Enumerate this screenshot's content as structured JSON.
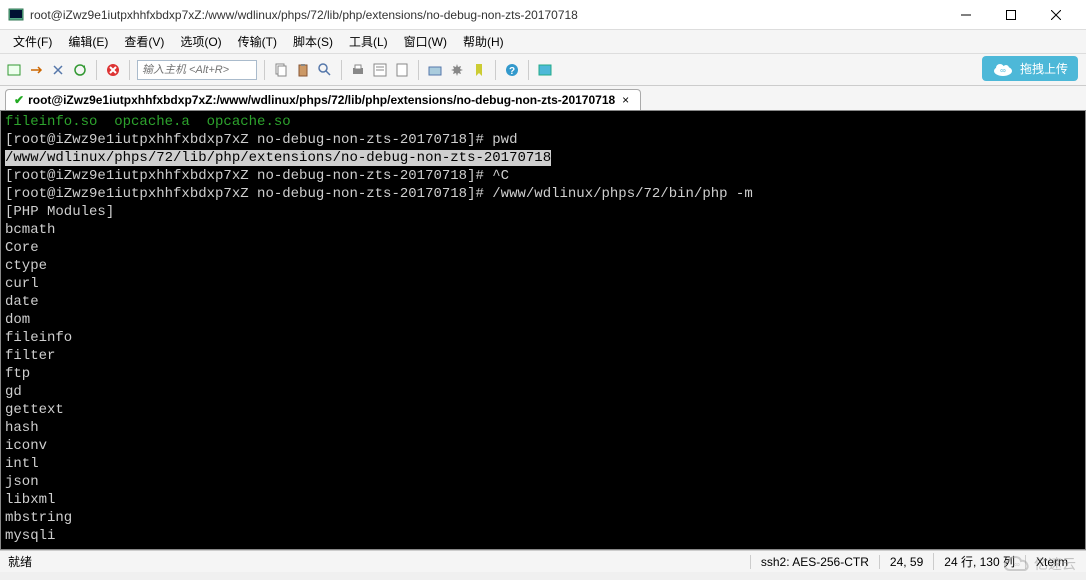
{
  "window": {
    "title": "root@iZwz9e1iutpxhhfxbdxp7xZ:/www/wdlinux/phps/72/lib/php/extensions/no-debug-non-zts-20170718"
  },
  "menubar": {
    "file": "文件(F)",
    "edit": "编辑(E)",
    "view": "查看(V)",
    "options": "选项(O)",
    "transfer": "传输(T)",
    "script": "脚本(S)",
    "tools": "工具(L)",
    "window": "窗口(W)",
    "help": "帮助(H)"
  },
  "toolbar": {
    "host_placeholder": "输入主机 <Alt+R>"
  },
  "upload_badge": {
    "label": "拖拽上传"
  },
  "tab": {
    "title": "root@iZwz9e1iutpxhhfxbdxp7xZ:/www/wdlinux/phps/72/lib/php/extensions/no-debug-non-zts-20170718",
    "close": "×"
  },
  "terminal": {
    "ls_output": "fileinfo.so  opcache.a  opcache.so",
    "prompt1": "[root@iZwz9e1iutpxhhfxbdxp7xZ no-debug-non-zts-20170718]# ",
    "cmd_pwd": "pwd",
    "pwd_output": "/www/wdlinux/phps/72/lib/php/extensions/no-debug-non-zts-20170718",
    "prompt2": "[root@iZwz9e1iutpxhhfxbdxp7xZ no-debug-non-zts-20170718]# ",
    "cmd_ctrlc": "^C",
    "prompt3": "[root@iZwz9e1iutpxhhfxbdxp7xZ no-debug-non-zts-20170718]# ",
    "cmd_phpm": "/www/wdlinux/phps/72/bin/php -m",
    "modules_header": "[PHP Modules]",
    "modules": [
      "bcmath",
      "Core",
      "ctype",
      "curl",
      "date",
      "dom",
      "fileinfo",
      "filter",
      "ftp",
      "gd",
      "gettext",
      "hash",
      "iconv",
      "intl",
      "json",
      "libxml",
      "mbstring",
      "mysqli"
    ]
  },
  "statusbar": {
    "ready": "就绪",
    "encryption": "ssh2: AES-256-CTR",
    "cursor": "24,  59",
    "size": "24 行, 130 列",
    "term_type": "Xterm"
  },
  "watermark": "亿速云"
}
